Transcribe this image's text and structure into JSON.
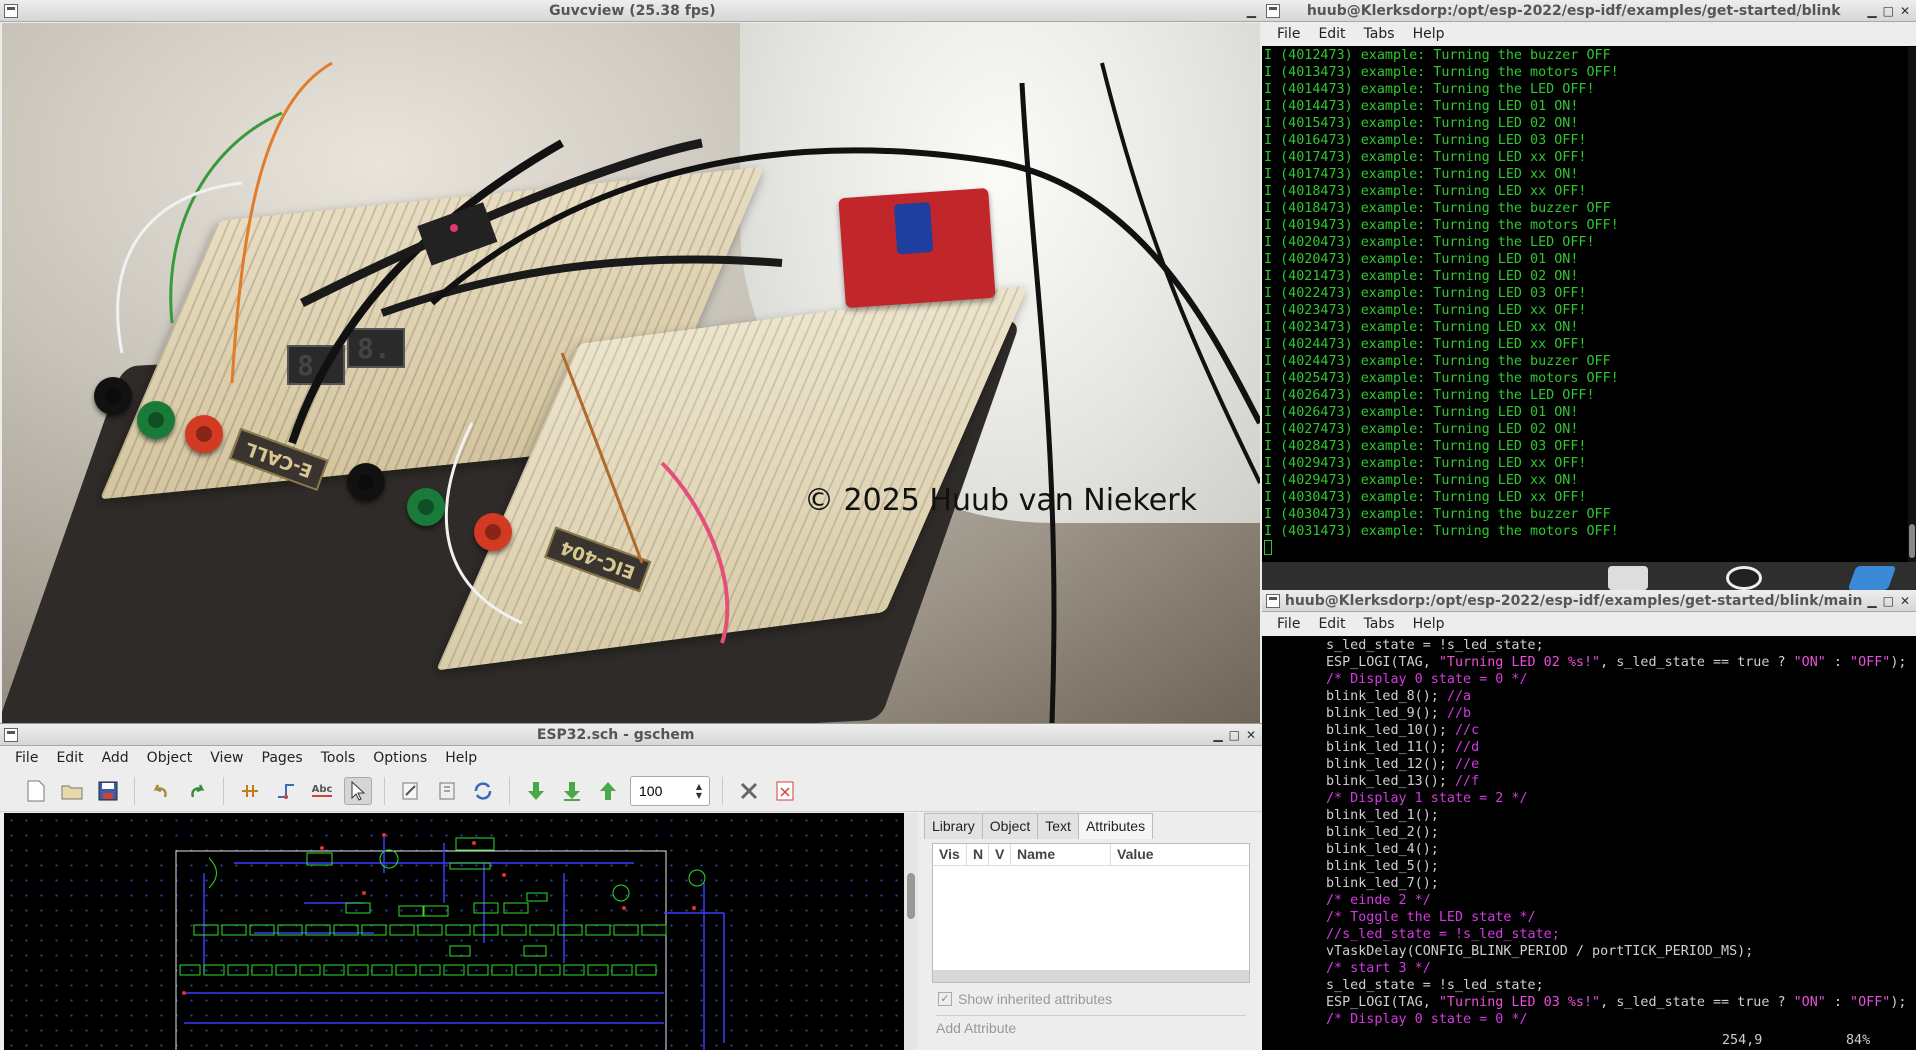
{
  "guvcview": {
    "title": "Guvcview  (25.38 fps)",
    "watermark": "© 2025 Huub van Niekerk"
  },
  "terminal_top": {
    "title": "huub@Klerksdorp:/opt/esp-2022/esp-idf/examples/get-started/blink",
    "menu": [
      "File",
      "Edit",
      "Tabs",
      "Help"
    ],
    "lines": [
      "I (4012473) example: Turning the buzzer OFF",
      "I (4013473) example: Turning the motors OFF!",
      "I (4014473) example: Turning the LED OFF!",
      "I (4014473) example: Turning LED 01 ON!",
      "I (4015473) example: Turning LED 02 ON!",
      "I (4016473) example: Turning LED 03 OFF!",
      "I (4017473) example: Turning LED xx OFF!",
      "I (4017473) example: Turning LED xx ON!",
      "I (4018473) example: Turning LED xx OFF!",
      "I (4018473) example: Turning the buzzer OFF",
      "I (4019473) example: Turning the motors OFF!",
      "I (4020473) example: Turning the LED OFF!",
      "I (4020473) example: Turning LED 01 ON!",
      "I (4021473) example: Turning LED 02 ON!",
      "I (4022473) example: Turning LED 03 OFF!",
      "I (4023473) example: Turning LED xx OFF!",
      "I (4023473) example: Turning LED xx ON!",
      "I (4024473) example: Turning LED xx OFF!",
      "I (4024473) example: Turning the buzzer OFF",
      "I (4025473) example: Turning the motors OFF!",
      "I (4026473) example: Turning the LED OFF!",
      "I (4026473) example: Turning LED 01 ON!",
      "I (4027473) example: Turning LED 02 ON!",
      "I (4028473) example: Turning LED 03 OFF!",
      "I (4029473) example: Turning LED xx OFF!",
      "I (4029473) example: Turning LED xx ON!",
      "I (4030473) example: Turning LED xx OFF!",
      "I (4030473) example: Turning the buzzer OFF",
      "I (4031473) example: Turning the motors OFF!"
    ]
  },
  "terminal_bottom": {
    "title": "huub@Klerksdorp:/opt/esp-2022/esp-idf/examples/get-started/blink/main",
    "menu": [
      "File",
      "Edit",
      "Tabs",
      "Help"
    ],
    "lines": [
      {
        "kind": "code",
        "text": "s_led_state = !s_led_state;"
      },
      {
        "kind": "logi",
        "pre": "ESP_LOGI(TAG, ",
        "str": "\"Turning LED 02 %s!\"",
        "post": ", s_led_state == true ? ",
        "s1": "\"ON\"",
        "mid": " : ",
        "s2": "\"OFF\"",
        "end": ");"
      },
      {
        "kind": "comment",
        "text": "/* Display 0 state = 0 */"
      },
      {
        "kind": "code_cmt",
        "code": "blink_led_8(); ",
        "cmt": "//a"
      },
      {
        "kind": "code_cmt",
        "code": "blink_led_9(); ",
        "cmt": "//b"
      },
      {
        "kind": "code_cmt",
        "code": "blink_led_10(); ",
        "cmt": "//c"
      },
      {
        "kind": "code_cmt",
        "code": "blink_led_11(); ",
        "cmt": "//d"
      },
      {
        "kind": "code_cmt",
        "code": "blink_led_12(); ",
        "cmt": "//e"
      },
      {
        "kind": "code_cmt",
        "code": "blink_led_13(); ",
        "cmt": "//f"
      },
      {
        "kind": "comment",
        "text": "/* Display 1 state = 2 */"
      },
      {
        "kind": "code",
        "text": "blink_led_1();"
      },
      {
        "kind": "code",
        "text": "blink_led_2();"
      },
      {
        "kind": "code",
        "text": "blink_led_4();"
      },
      {
        "kind": "code",
        "text": "blink_led_5();"
      },
      {
        "kind": "code",
        "text": "blink_led_7();"
      },
      {
        "kind": "comment",
        "text": "/* einde 2 */"
      },
      {
        "kind": "comment",
        "text": "/* Toggle the LED state */"
      },
      {
        "kind": "comment",
        "text": "//s_led_state = !s_led_state;"
      },
      {
        "kind": "code",
        "text": "vTaskDelay(CONFIG_BLINK_PERIOD / portTICK_PERIOD_MS);"
      },
      {
        "kind": "comment",
        "text": "/* start 3 */"
      },
      {
        "kind": "code",
        "text": "s_led_state = !s_led_state;"
      },
      {
        "kind": "logi",
        "pre": "ESP_LOGI(TAG, ",
        "str": "\"Turning LED 03 %s!\"",
        "post": ", s_led_state == true ? ",
        "s1": "\"ON\"",
        "mid": " : ",
        "s2": "\"OFF\"",
        "end": ");"
      },
      {
        "kind": "comment",
        "text": "/* Display 0 state = 0 */"
      }
    ],
    "status_pos": "254,9",
    "status_pct": "84%"
  },
  "gschem": {
    "title": "ESP32.sch - gschem",
    "menu": [
      "File",
      "Edit",
      "Add",
      "Object",
      "View",
      "Pages",
      "Tools",
      "Options",
      "Help"
    ],
    "zoom_value": "100",
    "tabs": [
      "Library",
      "Object",
      "Text",
      "Attributes"
    ],
    "selected_tab": "Attributes",
    "columns": [
      "Vis",
      "N",
      "V",
      "Name",
      "Value"
    ],
    "show_inherited": "Show inherited attributes",
    "add_attribute": "Add Attribute"
  }
}
